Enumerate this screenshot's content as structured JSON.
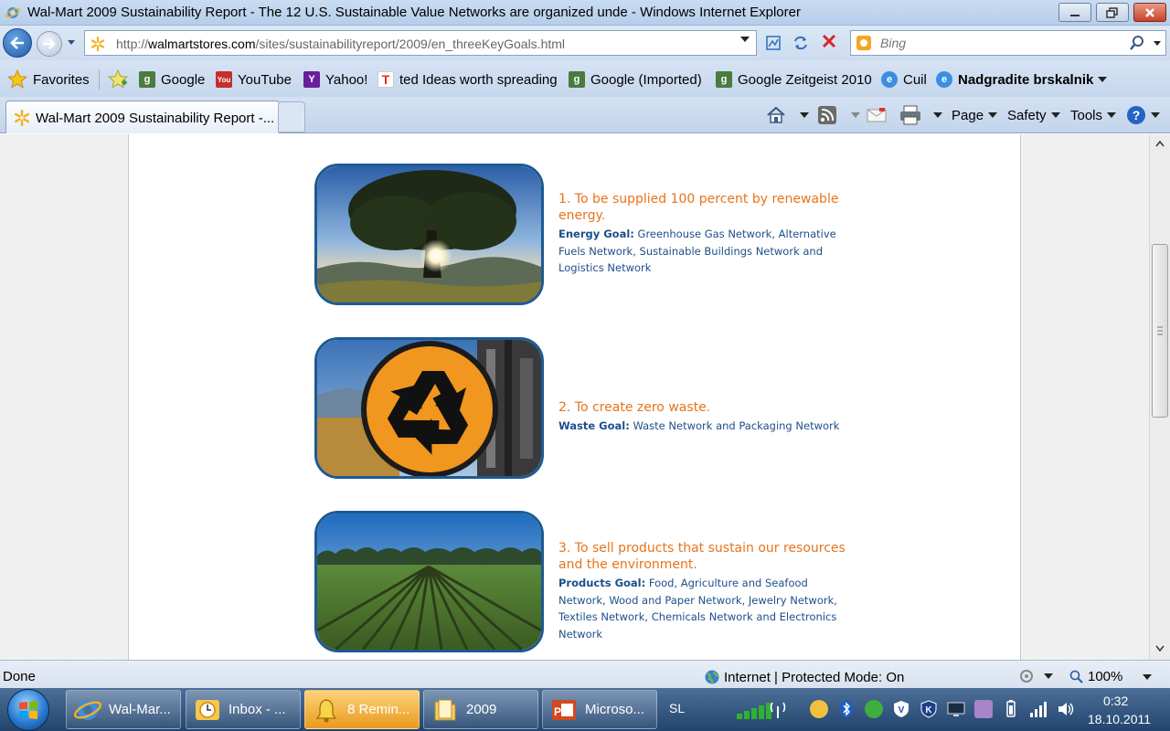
{
  "window": {
    "title": "Wal-Mart 2009 Sustainability Report - The 12 U.S. Sustainable Value Networks are organized unde - Windows Internet Explorer"
  },
  "address": {
    "url_prefix": "http://",
    "url_host": "walmartstores.com",
    "url_path": "/sites/sustainabilityreport/2009/en_threeKeyGoals.html"
  },
  "search": {
    "placeholder": "Bing"
  },
  "favorites": {
    "label": "Favorites",
    "items": [
      {
        "label": "Google"
      },
      {
        "label": "YouTube"
      },
      {
        "label": "Yahoo!"
      },
      {
        "label": "ted Ideas worth spreading"
      },
      {
        "label": "Google (Imported)"
      },
      {
        "label": "Google Zeitgeist 2010"
      },
      {
        "label": "Cuil"
      },
      {
        "label": "Nadgradite brskalnik"
      }
    ]
  },
  "tab": {
    "label": "Wal-Mart 2009 Sustainability Report -..."
  },
  "commands": {
    "page": "Page",
    "safety": "Safety",
    "tools": "Tools"
  },
  "goals": [
    {
      "title": "1. To be supplied 100 percent by renewable energy.",
      "goal_label": "Energy Goal:",
      "goal_text": " Greenhouse Gas Network, Alternative Fuels Network, Sustainable Buildings Network and Logistics Network"
    },
    {
      "title": "2. To create zero waste.",
      "goal_label": "Waste Goal:",
      "goal_text": " Waste Network and Packaging Network"
    },
    {
      "title": "3. To sell products that sustain our resources and the environment.",
      "goal_label": "Products Goal:",
      "goal_text": " Food, Agriculture and Seafood Network, Wood and Paper Network, Jewelry Network, Textiles Network, Chemicals Network and Electronics Network"
    }
  ],
  "status": {
    "text": "Done",
    "zone": "Internet | Protected Mode: On",
    "zoom": "100%"
  },
  "taskbar": {
    "items": [
      {
        "label": "Wal-Mar..."
      },
      {
        "label": "Inbox - ..."
      },
      {
        "label": "8 Remin..."
      },
      {
        "label": "2009"
      },
      {
        "label": "Microso..."
      }
    ],
    "language": "SL",
    "time": "0:32",
    "date": "18.10.2011"
  },
  "colors": {
    "goal_title": "#e8741a",
    "goal_text": "#1d4f8a",
    "image_border": "#1d5a93"
  }
}
